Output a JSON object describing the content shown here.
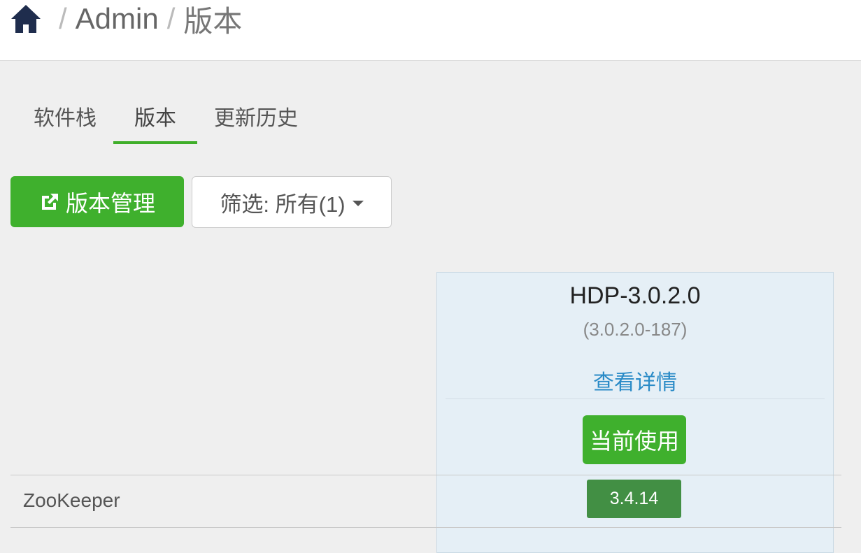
{
  "breadcrumb": {
    "home_icon": "home-icon",
    "separator": "/",
    "admin": "Admin",
    "current": "版本"
  },
  "tabs": [
    {
      "label": "软件栈",
      "active": false
    },
    {
      "label": "版本",
      "active": true
    },
    {
      "label": "更新历史",
      "active": false
    }
  ],
  "toolbar": {
    "manage_label": "版本管理",
    "manage_icon": "external-link-icon",
    "filter_label": "筛选: 所有(1)"
  },
  "version": {
    "name": "HDP-3.0.2.0",
    "build": "(3.0.2.0-187)",
    "details_link": "查看详情",
    "status_button": "当前使用"
  },
  "services": [
    {
      "name": "ZooKeeper",
      "version": "3.4.14"
    }
  ],
  "colors": {
    "accent_green": "#3fb02d",
    "version_badge": "#428f44",
    "link_blue": "#2a8bc7",
    "card_bg": "#e5eff6"
  }
}
